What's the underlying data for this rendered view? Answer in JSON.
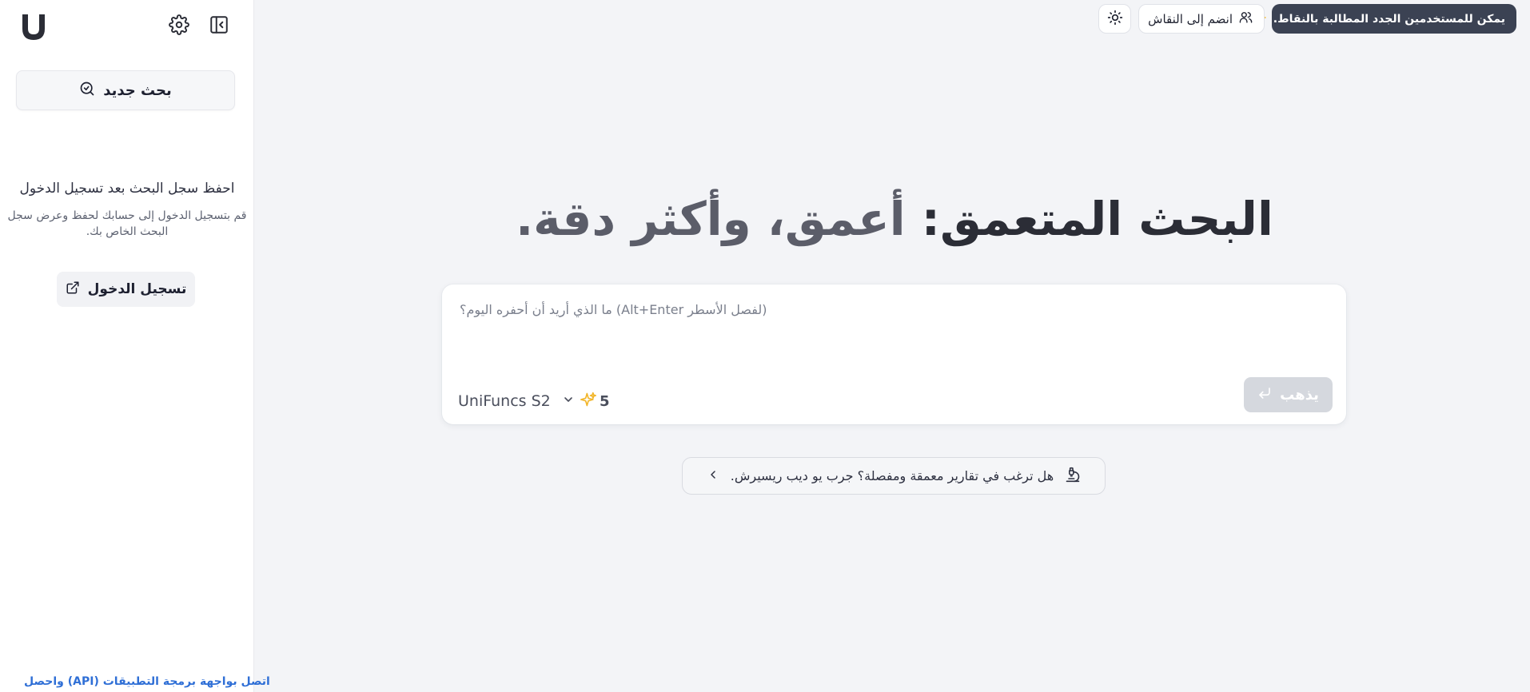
{
  "sidebar": {
    "logo_icon": "unifuncs-logo-icon",
    "settings_icon": "gear-icon",
    "collapse_icon": "sidebar-collapse-icon",
    "new_search_label": "بحث جديد",
    "history_title": "احفظ سجل البحث بعد تسجيل الدخول",
    "history_desc": "قم بتسجيل الدخول إلى حسابك لحفظ وعرض سجل البحث الخاص بك.",
    "login_label": "تسجيل الدخول",
    "api_link": "اتصل بواجهة برمجة التطبيقات (API) واحصل"
  },
  "topbar": {
    "promo_label": "يمكن للمستخدمين الجدد المطالبة بالنقاط.",
    "join_label": "انضم إلى النقاش",
    "theme_icon": "sun-icon"
  },
  "main": {
    "headline_part1": "البحث المتعمق:",
    "headline_part2": "أعمق، وأكثر دقة.",
    "query_placeholder": "(لفصل الأسطر Alt+Enter) ما الذي أريد أن أحفره اليوم؟",
    "query_value": "",
    "model_name": "UniFuncs S2",
    "credits": "5",
    "go_label": "يذهب",
    "deep_research_label": "هل ترغب في تقارير معمقة ومفصلة؟ جرب يو ديب ريسيرش."
  },
  "colors": {
    "accent_promo": "#3b4253",
    "go_disabled": "#d5d8de",
    "sparkle": "#f2b62b",
    "link": "#2f6fd6"
  }
}
